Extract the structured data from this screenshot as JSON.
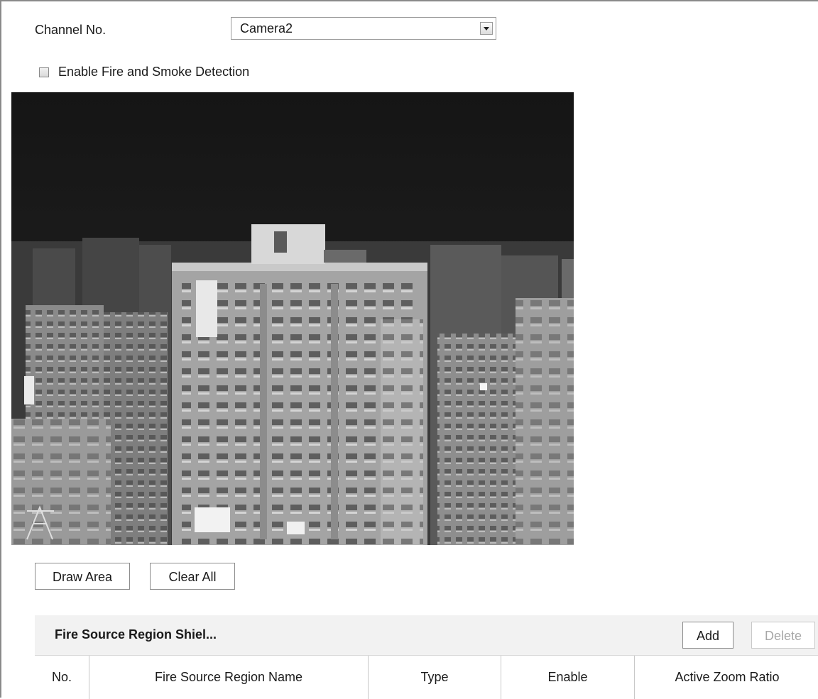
{
  "channel": {
    "label": "Channel No.",
    "selected": "Camera2"
  },
  "detection": {
    "enable_label": "Enable Fire and Smoke Detection",
    "enabled": false
  },
  "preview": {
    "description_icon": "thermal-camera-feed"
  },
  "buttons": {
    "draw_area": "Draw Area",
    "clear_all": "Clear All"
  },
  "shield_table": {
    "title": "Fire Source Region Shiel...",
    "add": "Add",
    "delete": "Delete",
    "columns": [
      "No.",
      "Fire Source Region Name",
      "Type",
      "Enable",
      "Active Zoom Ratio"
    ]
  },
  "colors": {
    "frame_border": "#8a8a8a",
    "header_bg": "#f2f2f2",
    "disabled_text": "#a7a7a7"
  }
}
